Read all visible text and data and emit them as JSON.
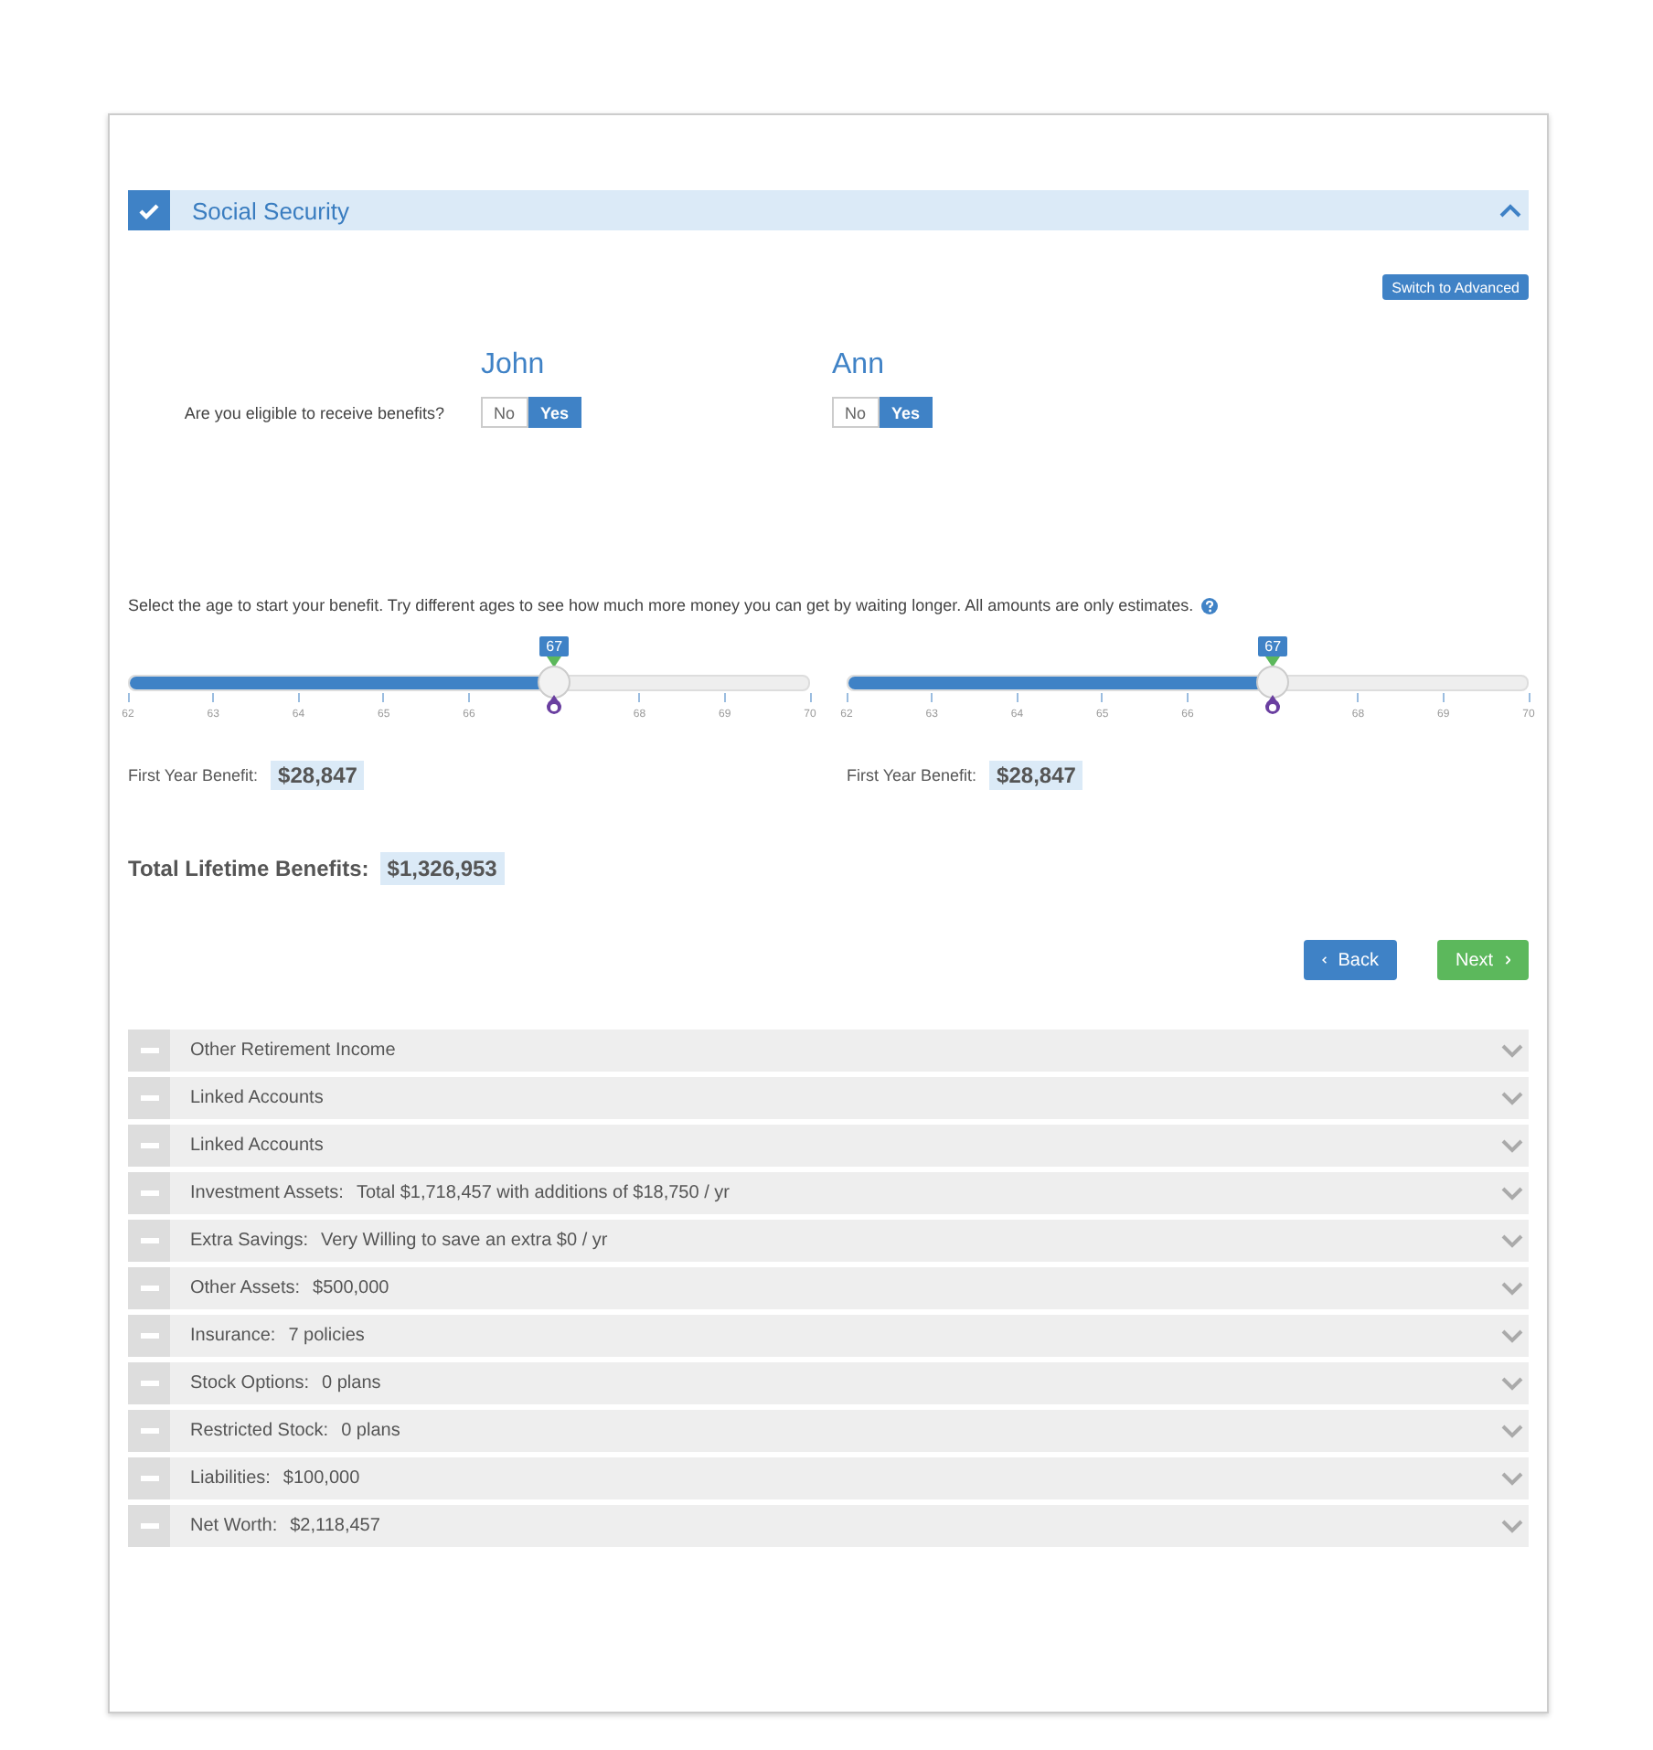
{
  "section": {
    "title": "Social Security",
    "checked": true,
    "expanded": true
  },
  "advanced_button": "Switch to Advanced",
  "people": [
    {
      "name": "John",
      "options": [
        {
          "label": "No",
          "selected": false
        },
        {
          "label": "Yes",
          "selected": true
        }
      ],
      "slider": {
        "value_label": "67",
        "level": 0.625,
        "ticks": [
          {
            "label": "62"
          },
          {
            "label": "63"
          },
          {
            "label": "64"
          },
          {
            "label": "65"
          },
          {
            "label": "66"
          },
          {
            "covered": true
          },
          {
            "label": "68"
          },
          {
            "label": "69"
          },
          {
            "label": "70"
          }
        ]
      },
      "first_year_label": "First Year Benefit:",
      "first_year_value": "$28,847"
    },
    {
      "name": "Ann",
      "options": [
        {
          "label": "No",
          "selected": false
        },
        {
          "label": "Yes",
          "selected": true
        }
      ],
      "slider": {
        "value_label": "67",
        "level": 0.625,
        "ticks": [
          {
            "label": "62"
          },
          {
            "label": "63"
          },
          {
            "label": "64"
          },
          {
            "label": "65"
          },
          {
            "label": "66"
          },
          {
            "covered": true
          },
          {
            "label": "68"
          },
          {
            "label": "69"
          },
          {
            "label": "70"
          }
        ]
      },
      "first_year_label": "First Year Benefit:",
      "first_year_value": "$28,847"
    }
  ],
  "eligibility_question": "Are you eligible to receive benefits?",
  "instruction": "Select the age to start your benefit. Try different ages to see how much more money you can get by waiting longer. All amounts are only estimates.",
  "total": {
    "label": "Total Lifetime Benefits:",
    "value": "$1,326,953"
  },
  "buttons": [
    {
      "label": "Back",
      "kind": "back"
    },
    {
      "label": "Next",
      "kind": "next"
    }
  ],
  "sections": [
    {
      "label": "Other Retirement Income",
      "expanded": false
    },
    {
      "label": "Linked Accounts",
      "expanded": false
    },
    {
      "label": "Linked Accounts",
      "expanded": false
    },
    {
      "label": "Investment Assets:",
      "value": "Total $1,718,457 with additions of $18,750 / yr",
      "expanded": false
    },
    {
      "label": "Extra Savings:",
      "value": "Very Willing to save an extra $0 / yr",
      "expanded": false
    },
    {
      "label": "Other Assets:",
      "value": "$500,000",
      "expanded": false
    },
    {
      "label": "Insurance:",
      "value": "7 policies",
      "expanded": false
    },
    {
      "label": "Stock Options:",
      "value": "0 plans",
      "expanded": false
    },
    {
      "label": "Restricted Stock:",
      "value": "0 plans",
      "expanded": false
    },
    {
      "label": "Liabilities:",
      "value": "$100,000",
      "expanded": false
    },
    {
      "label": "Net Worth:",
      "value": "$2,118,457",
      "expanded": false
    }
  ]
}
